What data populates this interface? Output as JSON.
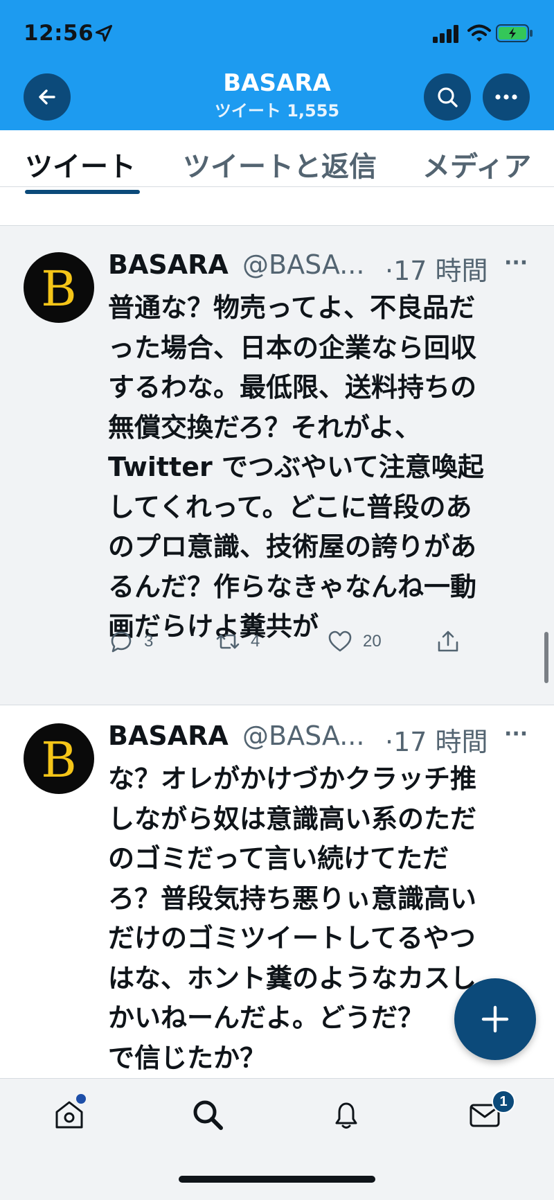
{
  "status_bar": {
    "time": "12:56"
  },
  "header": {
    "title": "BASARA",
    "subtitle": "ツイート 1,555"
  },
  "tabs": [
    {
      "label": "ツイート",
      "active": true
    },
    {
      "label": "ツイートと返信",
      "active": false
    },
    {
      "label": "メディア",
      "active": false
    }
  ],
  "tweets": [
    {
      "name": "BASARA",
      "handle": "@BASA...",
      "time": "·17 時間",
      "more": "···",
      "lines": [
        "普通な？物売ってよ、不良品だ",
        "った場合、日本の企業なら回収",
        "するわな。最低限、送料持ちの",
        "無償交換だろ？それがよ、",
        "Twitter でつぶやいて注意喚起",
        "してくれって。どこに普段のあ",
        "のプロ意識、技術屋の誇りがあ",
        "るんだ？作らなきゃなんね一動",
        "画だらけよ糞共が"
      ],
      "replies": "3",
      "retweets": "4",
      "likes": "20"
    },
    {
      "name": "BASARA",
      "handle": "@BASA...",
      "time": "·17 時間",
      "more": "···",
      "lines": [
        "な？オレがかけづかクラッチ推",
        "しながら奴は意識高い系のただ",
        "のゴミだって言い続けてただ",
        "ろ？普段気持ち悪りぃ意識高い",
        "だけのゴミツイートしてるやつ",
        "はな、ホント糞のようなカスし",
        "かいねーんだよ。どうだ？",
        "で信じたか？"
      ]
    }
  ],
  "tabbar": {
    "messages_badge": "1"
  },
  "colors": {
    "accent": "#1d9bf0",
    "dark_accent": "#0c4a7a",
    "avatar_letter": "#f5c518"
  },
  "icons": [
    "back-arrow-icon",
    "search-icon",
    "more-icon",
    "reply-icon",
    "retweet-icon",
    "like-icon",
    "share-icon",
    "compose-icon",
    "home-icon",
    "explore-icon",
    "notifications-icon",
    "messages-icon"
  ]
}
